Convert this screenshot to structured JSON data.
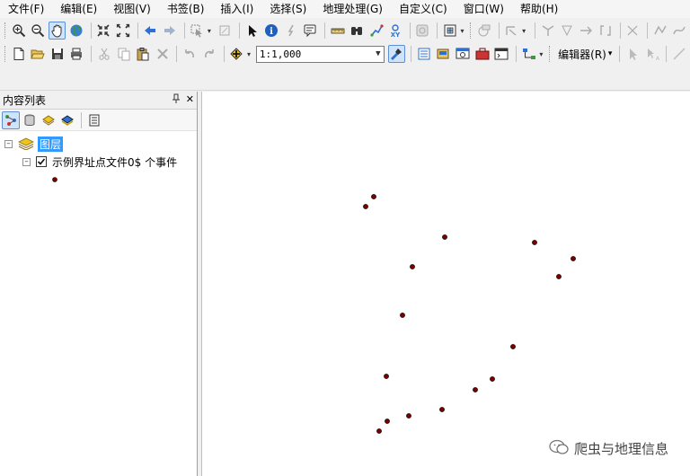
{
  "menubar": {
    "items": [
      "文件(F)",
      "编辑(E)",
      "视图(V)",
      "书签(B)",
      "插入(I)",
      "选择(S)",
      "地理处理(G)",
      "自定义(C)",
      "窗口(W)",
      "帮助(H)"
    ]
  },
  "toolbar": {
    "scale_value": "1:1,000",
    "editor_label": "编辑器(R)"
  },
  "toc": {
    "title": "内容列表",
    "pin_glyph": "ᵖ",
    "close_glyph": "✕",
    "layers_label": "图层",
    "layer_name": "示例界址点文件0$ 个事件",
    "expander_minus": "⊟",
    "checked": true
  },
  "map": {
    "point_color": "#7a0000",
    "points": [
      [
        0,
        0
      ],
      [
        1,
        0
      ],
      [
        2,
        0
      ],
      [
        3,
        0
      ],
      [
        4,
        0
      ],
      [
        5,
        0
      ],
      [
        6,
        0
      ],
      [
        7,
        0
      ],
      [
        8,
        0
      ],
      [
        9,
        0
      ],
      [
        10,
        0
      ],
      [
        11,
        0
      ],
      [
        12,
        0
      ],
      [
        13,
        0
      ],
      [
        14,
        0
      ],
      [
        15,
        0
      ],
      [
        16,
        0
      ]
    ]
  },
  "watermark": {
    "text": "爬虫与地理信息"
  },
  "colors": {
    "selection": "#3399ff",
    "active_tool": "#cfe3fb"
  },
  "icons": {
    "toolbar1": [
      "zoom-in-icon",
      "zoom-out-icon",
      "pan-hand-icon",
      "globe-full-extent-icon",
      "fixed-zoom-in-icon",
      "fixed-zoom-out-icon",
      "back-arrow-icon",
      "forward-arrow-icon",
      "select-features-icon",
      "clear-selection-icon",
      "select-elements-icon",
      "identify-icon",
      "hyperlink-icon",
      "html-popup-icon",
      "measure-icon",
      "find-icon",
      "find-route-icon",
      "go-to-xy-icon",
      "time-slider-icon",
      "create-viewer-icon"
    ],
    "toolbar2": [
      "new-document-icon",
      "open-folder-icon",
      "save-icon",
      "print-icon",
      "cut-icon",
      "copy-icon",
      "paste-icon",
      "delete-icon",
      "undo-icon",
      "redo-icon",
      "add-data-icon",
      "editor-toolbar-icon",
      "table-of-contents-icon",
      "catalog-icon",
      "search-window-icon",
      "arctoolbox-icon",
      "python-icon",
      "model-builder-icon"
    ]
  }
}
